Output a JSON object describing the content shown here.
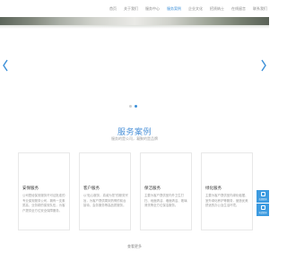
{
  "nav": {
    "items": [
      "首页",
      "关于我们",
      "服务中心",
      "服务案例",
      "企业文化",
      "招贤纳士",
      "在线留言",
      "联系我们"
    ],
    "active_index": 3
  },
  "hero": {
    "prev_icon": "chevron-left-icon",
    "next_icon": "chevron-right-icon",
    "dots": 2,
    "active_dot": 1
  },
  "section": {
    "title": "服务案例",
    "subtitle": "服务的是公司，凝聚的是品牌"
  },
  "cards": [
    {
      "title": "安保服务",
      "desc": "公司是经保安服务许可证批准的专业保安服务公司，拥有一支素质高、业务精的保安队伍，为客户提供全方位安全保障服务。"
    },
    {
      "title": "客户服务",
      "desc": "以“贴心服务，真诚为您”的服务宗旨，为客户提供周到热情的前台接待、会务服务等高品质服务。"
    },
    {
      "title": "保洁服务",
      "desc": "主要为客户提供室内外卫生打扫、地面清洁、墙面清洁、玻璃清洗等全方位保洁服务。"
    },
    {
      "title": "绿化服务",
      "desc": "主要为客户提供室内绿化租摆、室外绿化养护等服务，营造优美舒适的办公及生活环境。"
    }
  ],
  "more_label": "查看更多",
  "side_widget": {
    "buttons": [
      {
        "label": "在线咨询",
        "icon": "chat-icon"
      },
      {
        "label": "电话咨询",
        "icon": "phone-icon"
      }
    ]
  },
  "colors": {
    "accent": "#3b8fd8",
    "side_button": "#3d9be0"
  }
}
